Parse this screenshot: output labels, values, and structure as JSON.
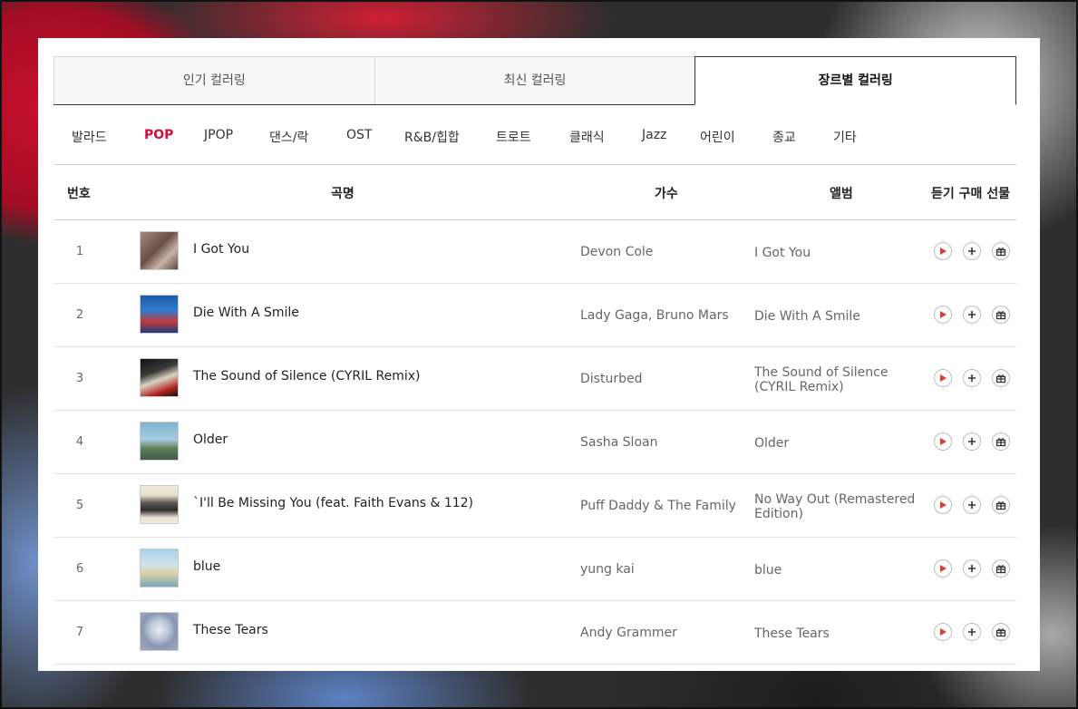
{
  "tabs": [
    "인기 컬러링",
    "최신 컬러링",
    "장르별 컬러링"
  ],
  "active_tab": 2,
  "genres": [
    "발라드",
    "POP",
    "JPOP",
    "댄스/락",
    "OST",
    "R&B/힙합",
    "트로트",
    "클래식",
    "Jazz",
    "어린이",
    "종교",
    "기타"
  ],
  "active_genre": 1,
  "columns": {
    "number": "번호",
    "song": "곡명",
    "artist": "가수",
    "album": "앨범",
    "actions": "듣기 구매 선물"
  },
  "colors": {
    "accent": "#d0103a",
    "play": "#e8372f"
  },
  "icons": {
    "play": "play-icon",
    "add": "plus-icon",
    "gift": "gift-icon"
  },
  "rows": [
    {
      "number": "1",
      "title": "I Got You",
      "artist": "Devon Cole",
      "album": "I Got You"
    },
    {
      "number": "2",
      "title": "Die With A Smile",
      "artist": "Lady Gaga, Bruno Mars",
      "album": "Die With A Smile"
    },
    {
      "number": "3",
      "title": "The Sound of Silence (CYRIL Remix)",
      "artist": "Disturbed",
      "album": "The Sound of Silence (CYRIL Remix)"
    },
    {
      "number": "4",
      "title": "Older",
      "artist": "Sasha Sloan",
      "album": "Older"
    },
    {
      "number": "5",
      "title": "`I'll Be Missing You (feat. Faith Evans & 112)",
      "artist": "Puff Daddy & The Family",
      "album": "No Way Out (Remastered Edition)"
    },
    {
      "number": "6",
      "title": "blue",
      "artist": "yung kai",
      "album": "blue"
    },
    {
      "number": "7",
      "title": "These Tears",
      "artist": "Andy Grammer",
      "album": "These Tears"
    }
  ]
}
